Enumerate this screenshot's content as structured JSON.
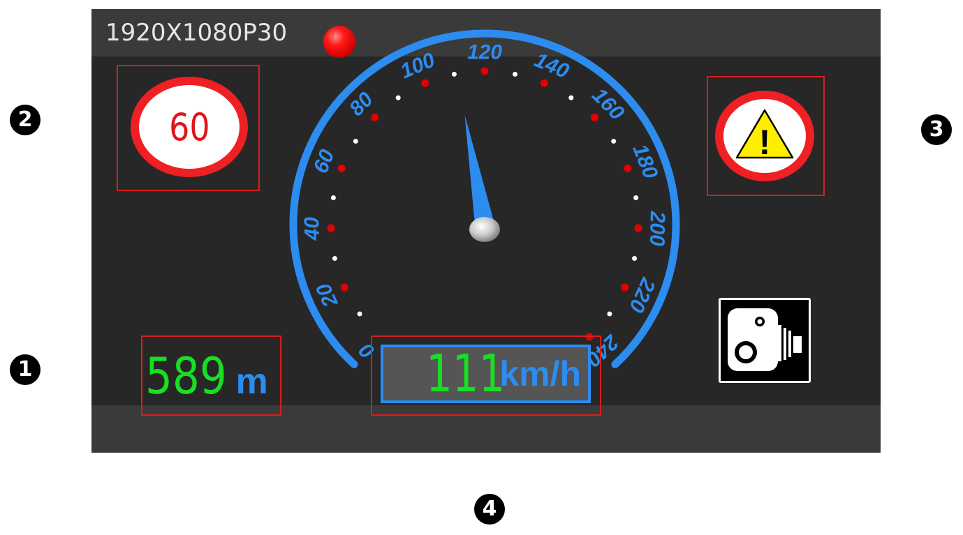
{
  "status_bar": {
    "resolution": "1920X1080P30",
    "recording_indicator_color": "#ff0000"
  },
  "speed_limit_sign": {
    "value": "60",
    "ring_color": "#ef2024"
  },
  "warning_sign": {
    "icon": "warning-triangle-icon",
    "mark": "!",
    "fill_color": "#ffee00"
  },
  "speedometer": {
    "min": 0,
    "max": 240,
    "tick_labels": [
      "0",
      "20",
      "40",
      "60",
      "80",
      "100",
      "120",
      "140",
      "160",
      "180",
      "200",
      "220",
      "240"
    ],
    "needle_value": 111,
    "accent_color": "#2d8cf0"
  },
  "distance": {
    "value": "589",
    "unit": "m",
    "value_color": "#17e022"
  },
  "speed_readout": {
    "value": "111",
    "unit": "km/h"
  },
  "camera_alert": {
    "icon": "speed-camera-icon"
  },
  "annotations": [
    "❶",
    "❷",
    "❸",
    "❹"
  ]
}
